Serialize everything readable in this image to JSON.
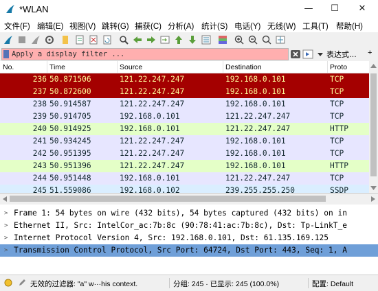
{
  "window": {
    "title": "*WLAN",
    "minimize": "—",
    "maximize": "☐",
    "close": "✕"
  },
  "menu": [
    "文件(F)",
    "编辑(E)",
    "视图(V)",
    "跳转(G)",
    "捕获(C)",
    "分析(A)",
    "统计(S)",
    "电话(Y)",
    "无线(W)",
    "工具(T)",
    "帮助(H)"
  ],
  "toolbar_icons": [
    "fin-start-icon",
    "stop-icon",
    "restart-icon",
    "options-icon",
    "open-file-icon",
    "save-file-icon",
    "close-file-icon",
    "reload-icon",
    "find-icon",
    "back-icon",
    "forward-icon",
    "go-to-icon",
    "first-icon",
    "last-icon",
    "autoscroll-icon",
    "colorize-icon",
    "zoom-in-icon",
    "zoom-out-icon",
    "zoom-normal-icon",
    "resize-columns-icon"
  ],
  "filter": {
    "placeholder": "Apply a display filter ...",
    "expression_label": "表达式…"
  },
  "columns": {
    "no": "No.",
    "time": "Time",
    "source": "Source",
    "destination": "Destination",
    "protocol": "Proto"
  },
  "packets": [
    {
      "no": "236",
      "time": "50.871506",
      "src": "121.22.247.247",
      "dst": "192.168.0.101",
      "proto": "TCP",
      "bg": "#a40000",
      "fg": "#fffc9c"
    },
    {
      "no": "237",
      "time": "50.872600",
      "src": "121.22.247.247",
      "dst": "192.168.0.101",
      "proto": "TCP",
      "bg": "#a40000",
      "fg": "#fffc9c"
    },
    {
      "no": "238",
      "time": "50.914587",
      "src": "121.22.247.247",
      "dst": "192.168.0.101",
      "proto": "TCP",
      "bg": "#e7e6ff",
      "fg": "#12272e"
    },
    {
      "no": "239",
      "time": "50.914705",
      "src": "192.168.0.101",
      "dst": "121.22.247.247",
      "proto": "TCP",
      "bg": "#e7e6ff",
      "fg": "#12272e"
    },
    {
      "no": "240",
      "time": "50.914925",
      "src": "192.168.0.101",
      "dst": "121.22.247.247",
      "proto": "HTTP",
      "bg": "#e4ffc7",
      "fg": "#12272e"
    },
    {
      "no": "241",
      "time": "50.934245",
      "src": "121.22.247.247",
      "dst": "192.168.0.101",
      "proto": "TCP",
      "bg": "#e7e6ff",
      "fg": "#12272e"
    },
    {
      "no": "242",
      "time": "50.951395",
      "src": "121.22.247.247",
      "dst": "192.168.0.101",
      "proto": "TCP",
      "bg": "#e7e6ff",
      "fg": "#12272e"
    },
    {
      "no": "243",
      "time": "50.951396",
      "src": "121.22.247.247",
      "dst": "192.168.0.101",
      "proto": "HTTP",
      "bg": "#e4ffc7",
      "fg": "#12272e"
    },
    {
      "no": "244",
      "time": "50.951448",
      "src": "192.168.0.101",
      "dst": "121.22.247.247",
      "proto": "TCP",
      "bg": "#e7e6ff",
      "fg": "#12272e"
    },
    {
      "no": "245",
      "time": "51.559086",
      "src": "192.168.0.102",
      "dst": "239.255.255.250",
      "proto": "SSDP",
      "bg": "#daeeff",
      "fg": "#12272e"
    }
  ],
  "details": [
    "Frame 1: 54 bytes on wire (432 bits), 54 bytes captured (432 bits) on in",
    "Ethernet II, Src: IntelCor_ac:7b:8c (90:78:41:ac:7b:8c), Dst: Tp-LinkT_e",
    "Internet Protocol Version 4, Src: 192.168.0.101, Dst: 61.135.169.125",
    "Transmission Control Protocol, Src Port: 64724, Dst Port: 443, Seq: 1, A"
  ],
  "status": {
    "filter_msg": "无效的过滤器: \"a\" w···his context.",
    "packets": "分组: 245 · 已显示: 245 (100.0%)",
    "profile": "配置: Default"
  },
  "colors": {
    "selected_detail": "#6f9fd8",
    "filter_invalid": "#ffafaf",
    "accent": "#3b6ab5"
  }
}
